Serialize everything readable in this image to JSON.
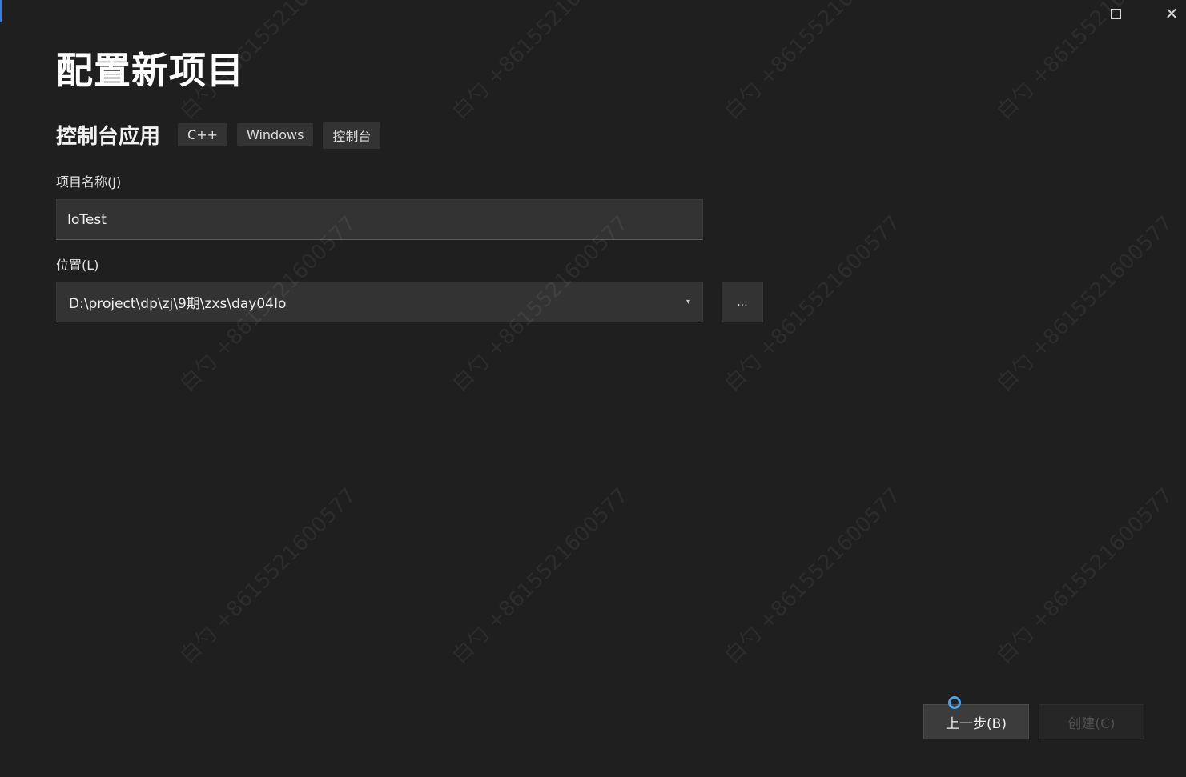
{
  "window": {
    "maximize_icon": "maximize-icon",
    "close_glyph": "✕"
  },
  "page": {
    "title": "配置新项目"
  },
  "template": {
    "name": "控制台应用",
    "tags": [
      "C++",
      "Windows",
      "控制台"
    ]
  },
  "project_name": {
    "label": "项目名称(J)",
    "value": "IoTest"
  },
  "location": {
    "label": "位置(L)",
    "value": "D:\\project\\dp\\zj\\9期\\zxs\\day04Io",
    "dropdown_glyph": "▾",
    "browse_label": "..."
  },
  "footer": {
    "back_label": "上一步(B)",
    "create_label": "创建(C)"
  },
  "watermark": {
    "text": "白勺 +8615521600577"
  },
  "colors": {
    "background": "#1f1f1f",
    "input_bg": "#333333",
    "accent": "#3b7ddd",
    "cursor": "#4aa3e8"
  }
}
